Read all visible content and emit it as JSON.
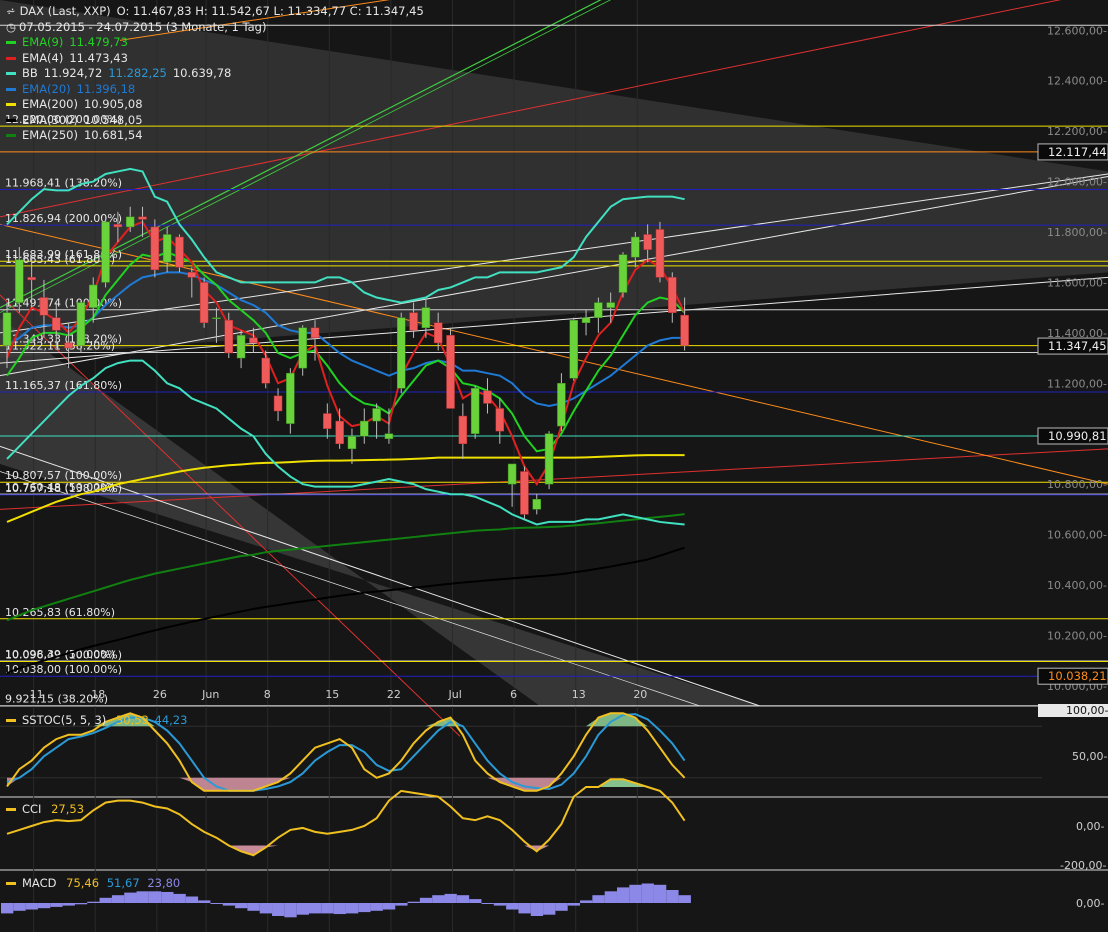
{
  "header": {
    "symbol": "DAX (Last, XXP)",
    "ohlc": "O: 11.467,83  H: 11.542,67  L: 11.334,77  C: 11.347,45",
    "period": "07.05.2015 - 24.07.2015 (3 Monate, 1 Tag)"
  },
  "legend": [
    {
      "label": "EMA(9)",
      "value": "11.479,73",
      "color": "#21d321"
    },
    {
      "label": "EMA(4)",
      "value": "11.473,43",
      "color": "#e02020"
    },
    {
      "label": "BB",
      "value": "11.924,72",
      "value2": "11.282,25",
      "value3": "10.639,78",
      "color": "#40e0c0"
    },
    {
      "label": "EMA(20)",
      "value": "11.396,18",
      "color": "#1f7ad6"
    },
    {
      "label": "EMA(200)",
      "value": "10.905,08",
      "color": "#f0e000"
    },
    {
      "label": "EMA(300)",
      "value": "10.548,05",
      "color": "#000000"
    },
    {
      "label": "EMA(250)",
      "value": "10.681,54",
      "color": "#108010"
    }
  ],
  "colors": {
    "bg": "#161616",
    "up": "#6ad23a",
    "down": "#ef5b5b",
    "ema9": "#21d321",
    "ema4": "#e02020",
    "bb": "#40e0c0",
    "ema20": "#1f7ad6",
    "ema200": "#f0e000",
    "ema300": "#000000",
    "ema250": "#108010",
    "stoch_k": "#f0c020",
    "stoch_d": "#2a9ad6",
    "cci": "#f0c020",
    "macd": "#f0c020",
    "hist": "#8c88e8"
  },
  "x_axis": {
    "labels": [
      "11",
      "18",
      "26",
      "Jun",
      "8",
      "15",
      "22",
      "Jul",
      "6",
      "13",
      "20"
    ]
  },
  "y_axis": {
    "labels": [
      "12.600,00-",
      "12.400,00-",
      "12.200,00-",
      "12.000,00-",
      "11.800,00-",
      "11.600,00-",
      "11.400,00-",
      "11.200,00-",
      "10.800,00-",
      "10.600,00-",
      "10.400,00-",
      "10.200,00-",
      "10.000,00-"
    ]
  },
  "price_tags": [
    {
      "text": "12.117,44",
      "price": 12117.44
    },
    {
      "text": "11.347,45",
      "price": 11347.45
    },
    {
      "text": "10.990,81",
      "price": 10990.81
    },
    {
      "text": "10.038,21",
      "price": 10038.21
    }
  ],
  "fib_levels": [
    {
      "text": "12.220,00 (200.00%)",
      "price": 12220,
      "color": "#f0e000"
    },
    {
      "text": "11.968,41 (138.20%)",
      "price": 11968.41,
      "color": "#2020c0"
    },
    {
      "text": "11.826,94 (200.00%)",
      "price": 11826.94,
      "color": "#2020c0"
    },
    {
      "text": "11.683,99 (161.80%)",
      "price": 11683.99,
      "color": "#f0e000"
    },
    {
      "text": "11.665,43 (61.80%)",
      "price": 11665.43,
      "color": "#f0e000"
    },
    {
      "text": "11.491,74 (100.00%)",
      "price": 11491.74,
      "color": "#d0d0d0"
    },
    {
      "text": "11.349,33 (138.20%)",
      "price": 11349.33,
      "color": "#f0e000"
    },
    {
      "text": "11.322,11 (38.20%)",
      "price": 11322.11,
      "color": "#d0d0d0"
    },
    {
      "text": "11.165,37 (161.80%)",
      "price": 11165.37,
      "color": "#2020c0"
    },
    {
      "text": "10.807,57 (100.00%)",
      "price": 10807.57,
      "color": "#f0e000"
    },
    {
      "text": "10.760,48 (50.00%)",
      "price": 10760.48,
      "color": "#d0d0d0"
    },
    {
      "text": "10.757,18 (138.20%)",
      "price": 10757.18,
      "color": "#2020c0"
    },
    {
      "text": "10.265,83 (61.80%)",
      "price": 10265.83,
      "color": "#f0e000"
    },
    {
      "text": "10.098,39 (50.00%)",
      "price": 10098.39,
      "color": "#d0d0d0"
    },
    {
      "text": "10.096,49 (100.00%)",
      "price": 10096.49,
      "color": "#f0e000"
    },
    {
      "text": "10.038,00 (100.00%)",
      "price": 10038.0,
      "color": "#2020c0"
    },
    {
      "text": "9.921,15 (38.20%)",
      "price": 9921.15,
      "color": "#d0d0d0"
    }
  ],
  "stoch": {
    "label": "SSTOC(5, 5, 3)",
    "value": "30,53",
    "value2": "44,23",
    "axis": [
      "100,00-",
      "50,00-"
    ]
  },
  "cci": {
    "label": "CCI",
    "value": "27,53",
    "axis": [
      "0,00-",
      "-200,00-"
    ]
  },
  "macd": {
    "label": "MACD",
    "value": "75,46",
    "value2": "51,67",
    "value3": "23,80",
    "axis": [
      "0,00-"
    ]
  },
  "chart_data": {
    "type": "candlestick",
    "dates": [
      "07.05",
      "08.05",
      "11.05",
      "12.05",
      "13.05",
      "14.05",
      "15.05",
      "18.05",
      "19.05",
      "20.05",
      "21.05",
      "22.05",
      "26.05",
      "27.05",
      "28.05",
      "29.05",
      "01.06",
      "02.06",
      "03.06",
      "04.06",
      "05.06",
      "08.06",
      "09.06",
      "10.06",
      "11.06",
      "12.06",
      "15.06",
      "16.06",
      "17.06",
      "18.06",
      "19.06",
      "22.06",
      "23.06",
      "24.06",
      "25.06",
      "26.06",
      "29.06",
      "30.06",
      "01.07",
      "02.07",
      "03.07",
      "06.07",
      "07.07",
      "08.07",
      "09.07",
      "10.07",
      "13.07",
      "14.07",
      "15.07",
      "16.07",
      "17.07",
      "20.07",
      "21.07",
      "22.07",
      "23.07",
      "24.07"
    ],
    "ohlc": [
      [
        11350,
        11520,
        11260,
        11480
      ],
      [
        11520,
        11740,
        11480,
        11690
      ],
      [
        11620,
        11700,
        11500,
        11610
      ],
      [
        11540,
        11610,
        11380,
        11470
      ],
      [
        11460,
        11520,
        11340,
        11410
      ],
      [
        11360,
        11440,
        11260,
        11340
      ],
      [
        11350,
        11530,
        11320,
        11520
      ],
      [
        11500,
        11620,
        11440,
        11590
      ],
      [
        11600,
        11860,
        11580,
        11840
      ],
      [
        11830,
        11880,
        11760,
        11820
      ],
      [
        11820,
        11900,
        11800,
        11860
      ],
      [
        11860,
        11900,
        11780,
        11850
      ],
      [
        11820,
        11850,
        11620,
        11650
      ],
      [
        11680,
        11820,
        11640,
        11790
      ],
      [
        11780,
        11790,
        11640,
        11660
      ],
      [
        11640,
        11660,
        11540,
        11620
      ],
      [
        11600,
        11620,
        11420,
        11440
      ],
      [
        11460,
        11500,
        11360,
        11460
      ],
      [
        11450,
        11480,
        11300,
        11320
      ],
      [
        11300,
        11410,
        11260,
        11390
      ],
      [
        11380,
        11420,
        11320,
        11360
      ],
      [
        11300,
        11330,
        11180,
        11200
      ],
      [
        11150,
        11180,
        11050,
        11090
      ],
      [
        11040,
        11260,
        11000,
        11240
      ],
      [
        11260,
        11430,
        11230,
        11420
      ],
      [
        11420,
        11450,
        11290,
        11380
      ],
      [
        11080,
        11120,
        10980,
        11020
      ],
      [
        11050,
        11100,
        10940,
        10960
      ],
      [
        10940,
        11020,
        10880,
        10990
      ],
      [
        10990,
        11100,
        10960,
        11050
      ],
      [
        11050,
        11120,
        10980,
        11100
      ],
      [
        10980,
        11100,
        10960,
        11000
      ],
      [
        11180,
        11480,
        11160,
        11460
      ],
      [
        11480,
        11520,
        11380,
        11410
      ],
      [
        11420,
        11530,
        11380,
        11500
      ],
      [
        11440,
        11480,
        11330,
        11360
      ],
      [
        11390,
        11420,
        11100,
        11100
      ],
      [
        11070,
        11120,
        10900,
        10960
      ],
      [
        11000,
        11190,
        10980,
        11180
      ],
      [
        11170,
        11220,
        11080,
        11120
      ],
      [
        11100,
        11140,
        10960,
        11010
      ],
      [
        10800,
        10880,
        10710,
        10880
      ],
      [
        10850,
        10870,
        10660,
        10680
      ],
      [
        10700,
        10760,
        10680,
        10740
      ],
      [
        10800,
        11010,
        10780,
        11000
      ],
      [
        11030,
        11240,
        11010,
        11200
      ],
      [
        11220,
        11460,
        11210,
        11450
      ],
      [
        11440,
        11490,
        11390,
        11460
      ],
      [
        11460,
        11540,
        11400,
        11520
      ],
      [
        11500,
        11560,
        11440,
        11520
      ],
      [
        11560,
        11720,
        11540,
        11710
      ],
      [
        11700,
        11800,
        11660,
        11780
      ],
      [
        11790,
        11830,
        11680,
        11730
      ],
      [
        11810,
        11840,
        11600,
        11620
      ],
      [
        11620,
        11640,
        11440,
        11480
      ],
      [
        11470,
        11540,
        11330,
        11350
      ]
    ],
    "series": {
      "bb_upper": [
        11830,
        11880,
        11930,
        11970,
        11965,
        11965,
        11990,
        12000,
        12030,
        12040,
        12050,
        12040,
        11940,
        11920,
        11830,
        11770,
        11700,
        11640,
        11620,
        11600,
        11600,
        11600,
        11600,
        11600,
        11600,
        11600,
        11620,
        11620,
        11600,
        11560,
        11540,
        11530,
        11520,
        11530,
        11540,
        11570,
        11580,
        11600,
        11620,
        11620,
        11640,
        11640,
        11640,
        11640,
        11650,
        11660,
        11700,
        11780,
        11840,
        11900,
        11930,
        11935,
        11940,
        11940,
        11940,
        11930
      ],
      "bb_lower": [
        10900,
        10950,
        11000,
        11050,
        11100,
        11150,
        11190,
        11220,
        11260,
        11280,
        11290,
        11290,
        11250,
        11200,
        11180,
        11140,
        11120,
        11100,
        11060,
        11020,
        10990,
        10920,
        10870,
        10830,
        10800,
        10790,
        10790,
        10790,
        10790,
        10800,
        10810,
        10820,
        10810,
        10800,
        10780,
        10770,
        10760,
        10760,
        10750,
        10730,
        10710,
        10680,
        10660,
        10640,
        10650,
        10650,
        10650,
        10660,
        10660,
        10670,
        10680,
        10670,
        10660,
        10650,
        10645,
        10640
      ],
      "ema4": [
        11300,
        11420,
        11500,
        11480,
        11450,
        11400,
        11460,
        11550,
        11700,
        11760,
        11820,
        11840,
        11760,
        11780,
        11730,
        11680,
        11570,
        11520,
        11430,
        11410,
        11390,
        11310,
        11200,
        11220,
        11320,
        11350,
        11190,
        11070,
        11030,
        11040,
        11070,
        11040,
        11230,
        11320,
        11400,
        11380,
        11270,
        11140,
        11170,
        11150,
        11090,
        10990,
        10870,
        10800,
        10880,
        11030,
        11200,
        11300,
        11390,
        11440,
        11560,
        11650,
        11690,
        11660,
        11580,
        11480
      ],
      "ema9": [
        11230,
        11300,
        11380,
        11400,
        11400,
        11390,
        11420,
        11460,
        11550,
        11610,
        11670,
        11710,
        11700,
        11720,
        11700,
        11680,
        11630,
        11590,
        11530,
        11490,
        11450,
        11400,
        11320,
        11300,
        11320,
        11330,
        11270,
        11200,
        11150,
        11120,
        11110,
        11080,
        11150,
        11210,
        11270,
        11290,
        11260,
        11200,
        11190,
        11170,
        11140,
        11080,
        10990,
        10930,
        10940,
        11000,
        11090,
        11170,
        11250,
        11310,
        11390,
        11470,
        11520,
        11540,
        11530,
        11480
      ],
      "ema20": [
        11350,
        11380,
        11420,
        11430,
        11430,
        11420,
        11430,
        11460,
        11510,
        11550,
        11590,
        11620,
        11630,
        11640,
        11640,
        11630,
        11610,
        11590,
        11560,
        11530,
        11510,
        11480,
        11430,
        11410,
        11400,
        11400,
        11360,
        11320,
        11290,
        11270,
        11250,
        11230,
        11250,
        11260,
        11280,
        11290,
        11280,
        11250,
        11250,
        11240,
        11230,
        11200,
        11150,
        11120,
        11110,
        11120,
        11140,
        11170,
        11200,
        11230,
        11270,
        11310,
        11350,
        11370,
        11380,
        11380
      ],
      "ema200": [
        10650,
        10670,
        10690,
        10710,
        10730,
        10745,
        10760,
        10770,
        10785,
        10800,
        10810,
        10820,
        10830,
        10840,
        10850,
        10858,
        10865,
        10870,
        10875,
        10878,
        10882,
        10884,
        10885,
        10887,
        10890,
        10892,
        10893,
        10893,
        10894,
        10895,
        10896,
        10897,
        10898,
        10900,
        10902,
        10905,
        10905,
        10905,
        10905,
        10905,
        10905,
        10905,
        10905,
        10905,
        10905,
        10905,
        10905,
        10906,
        10908,
        10910,
        10912,
        10914,
        10915,
        10915,
        10915,
        10915
      ],
      "ema250": [
        10260,
        10280,
        10300,
        10315,
        10330,
        10345,
        10360,
        10375,
        10390,
        10405,
        10420,
        10432,
        10445,
        10455,
        10465,
        10475,
        10485,
        10495,
        10505,
        10515,
        10520,
        10530,
        10535,
        10540,
        10545,
        10550,
        10555,
        10560,
        10565,
        10570,
        10575,
        10580,
        10585,
        10590,
        10595,
        10600,
        10605,
        10610,
        10615,
        10618,
        10620,
        10625,
        10627,
        10628,
        10630,
        10632,
        10636,
        10640,
        10645,
        10650,
        10655,
        10660,
        10665,
        10670,
        10675,
        10681
      ],
      "ema300": [
        10050,
        10070,
        10085,
        10100,
        10115,
        10130,
        10145,
        10158,
        10170,
        10182,
        10195,
        10208,
        10220,
        10232,
        10243,
        10254,
        10265,
        10275,
        10285,
        10295,
        10305,
        10313,
        10320,
        10328,
        10335,
        10342,
        10350,
        10357,
        10363,
        10369,
        10374,
        10379,
        10384,
        10389,
        10394,
        10400,
        10405,
        10410,
        10414,
        10418,
        10422,
        10426,
        10430,
        10434,
        10438,
        10443,
        10450,
        10457,
        10465,
        10473,
        10482,
        10491,
        10501,
        10516,
        10532,
        10548
      ]
    },
    "stoch_k": [
      10,
      30,
      40,
      55,
      65,
      70,
      70,
      75,
      85,
      90,
      95,
      90,
      75,
      60,
      40,
      15,
      5,
      5,
      5,
      5,
      5,
      10,
      15,
      25,
      40,
      55,
      60,
      65,
      55,
      30,
      20,
      25,
      40,
      60,
      75,
      85,
      90,
      70,
      40,
      25,
      15,
      10,
      5,
      5,
      10,
      25,
      45,
      70,
      90,
      95,
      95,
      90,
      75,
      55,
      35,
      20
    ],
    "stoch_d": [
      15,
      20,
      30,
      45,
      55,
      65,
      68,
      72,
      78,
      85,
      90,
      90,
      85,
      75,
      60,
      40,
      20,
      10,
      5,
      5,
      5,
      7,
      10,
      15,
      25,
      40,
      50,
      58,
      58,
      50,
      35,
      28,
      30,
      45,
      60,
      75,
      85,
      80,
      60,
      40,
      25,
      15,
      10,
      8,
      7,
      12,
      25,
      45,
      70,
      85,
      93,
      94,
      88,
      75,
      60,
      40
    ],
    "cci": [
      -40,
      -20,
      0,
      20,
      30,
      25,
      30,
      80,
      120,
      130,
      130,
      120,
      100,
      90,
      60,
      10,
      -30,
      -60,
      -100,
      -130,
      -150,
      -110,
      -60,
      -20,
      -10,
      -30,
      -40,
      -30,
      -20,
      0,
      40,
      130,
      180,
      170,
      160,
      150,
      100,
      40,
      30,
      50,
      30,
      -20,
      -80,
      -130,
      -70,
      10,
      150,
      200,
      200,
      240,
      240,
      220,
      200,
      180,
      120,
      27
    ],
    "macd_hist": [
      -80,
      -60,
      -50,
      -40,
      -30,
      -20,
      -10,
      10,
      40,
      60,
      80,
      90,
      90,
      85,
      70,
      50,
      20,
      0,
      -20,
      -40,
      -60,
      -80,
      -100,
      -110,
      -90,
      -80,
      -80,
      -85,
      -80,
      -70,
      -60,
      -50,
      -20,
      10,
      40,
      60,
      70,
      60,
      30,
      0,
      -20,
      -50,
      -80,
      -100,
      -90,
      -60,
      -20,
      20,
      60,
      90,
      120,
      140,
      150,
      140,
      100,
      60
    ]
  }
}
